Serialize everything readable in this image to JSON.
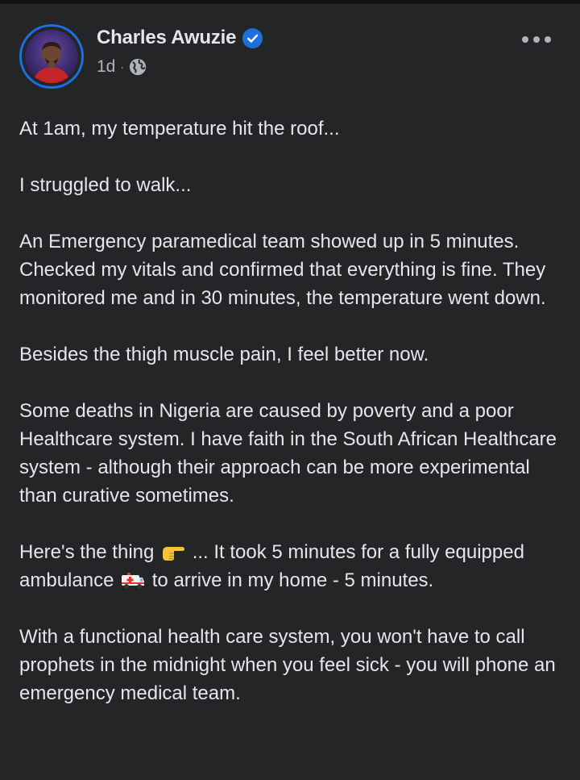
{
  "post": {
    "author": "Charles Awuzie",
    "timestamp": "1d",
    "separator": "·",
    "paragraphs": {
      "p1": "At 1am, my temperature hit the roof...",
      "p2": "I struggled to walk...",
      "p3": "An Emergency paramedical team showed up in 5 minutes. Checked my vitals and confirmed that everything is fine. They monitored me and in 30 minutes, the temperature went down.",
      "p4": "Besides the thigh muscle pain, I feel better now.",
      "p5": "Some deaths in Nigeria are caused by poverty and a poor Healthcare system. I have faith in the South African Healthcare system - although their approach can be more experimental than curative sometimes.",
      "p6a": "Here's the thing",
      "p6b": "... It took 5 minutes for a fully equipped ambulance",
      "p6c": "to arrive in my home - 5 minutes.",
      "p7": "With a functional health care system, you won't have to call prophets in the midnight when you feel sick - you will phone an emergency medical team."
    }
  },
  "icons": {
    "verified": "verified-badge-icon",
    "privacy": "globe-icon",
    "more": "more-options-icon",
    "emoji1": "pointing-right-emoji",
    "emoji2": "ambulance-emoji"
  },
  "colors": {
    "background": "#242526",
    "text": "#e4e6eb",
    "secondary_text": "#b0b3b8",
    "accent": "#1d6fe0"
  }
}
